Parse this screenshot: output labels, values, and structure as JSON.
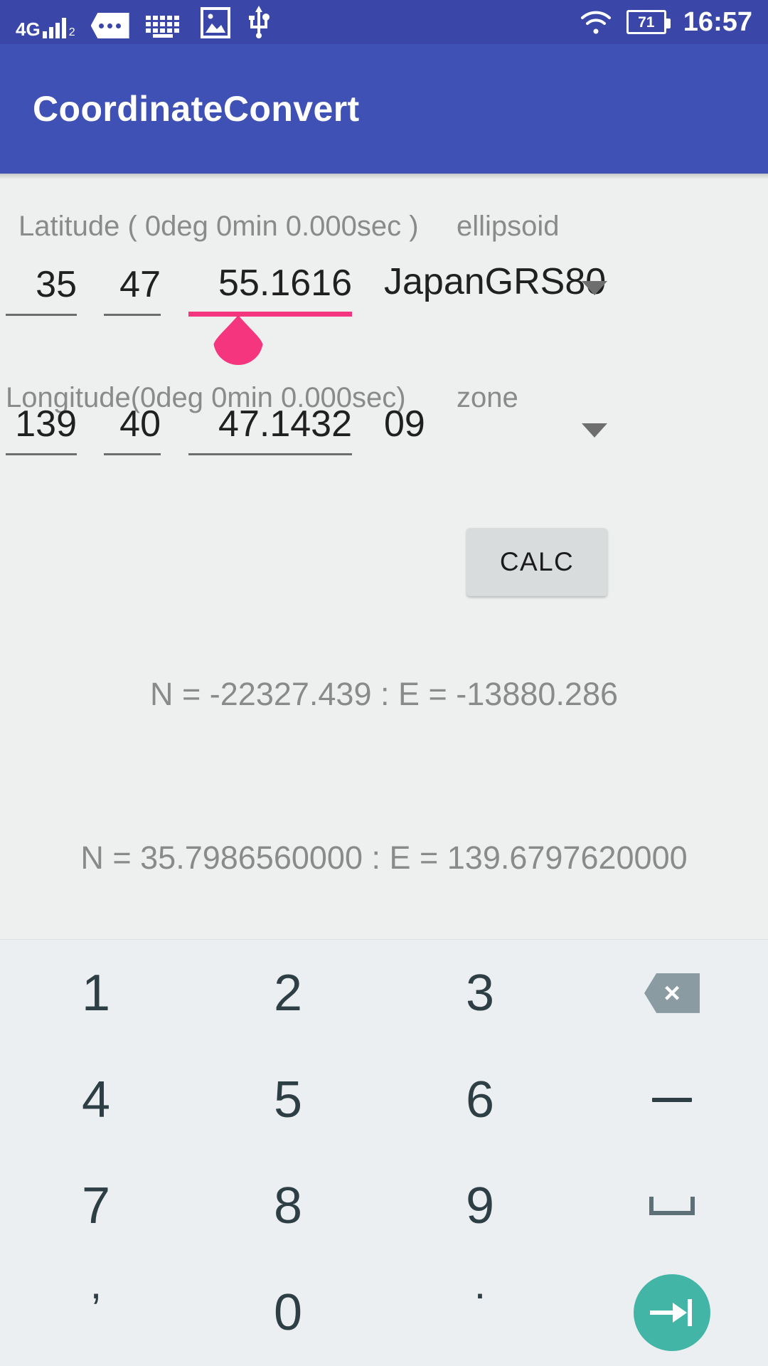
{
  "status_bar": {
    "network_label": "4G",
    "network_sub": "2",
    "battery_level": "71",
    "time": "16:57",
    "icons": [
      "signal-4g-icon",
      "sim-message-icon",
      "keyboard-icon",
      "image-icon",
      "usb-icon",
      "wifi-icon",
      "battery-icon"
    ]
  },
  "app_bar": {
    "title": "CoordinateConvert"
  },
  "form": {
    "latitude": {
      "label": "Latitude ( 0deg 0min 0.000sec )",
      "deg": "35",
      "min": "47",
      "sec": "55.1616",
      "focused_field": "sec"
    },
    "ellipsoid": {
      "label": "ellipsoid",
      "value": "JapanGRS80"
    },
    "longitude": {
      "label": "Longitude(0deg 0min 0.000sec)",
      "deg": "139",
      "min": "40",
      "sec": "47.1432"
    },
    "zone": {
      "label": "zone",
      "value": "09"
    },
    "calc_button": "CALC"
  },
  "results": {
    "line1": "N = -22327.439 : E = -13880.286",
    "line2": "N = 35.7986560000 : E = 139.6797620000"
  },
  "keyboard": {
    "k1": "1",
    "k2": "2",
    "k3": "3",
    "k4": "4",
    "k5": "5",
    "k6": "6",
    "k7": "7",
    "k8": "8",
    "k9": "9",
    "k0": "0",
    "comma": ",",
    "period": ".",
    "backspace_glyph": "×"
  },
  "colors": {
    "status_bar": "#3a47a8",
    "app_bar": "#3f51b5",
    "accent_focus": "#f5367f",
    "enter_key": "#43b5a6",
    "page_bg": "#eff0f0",
    "keyboard_bg": "#eceff1"
  }
}
